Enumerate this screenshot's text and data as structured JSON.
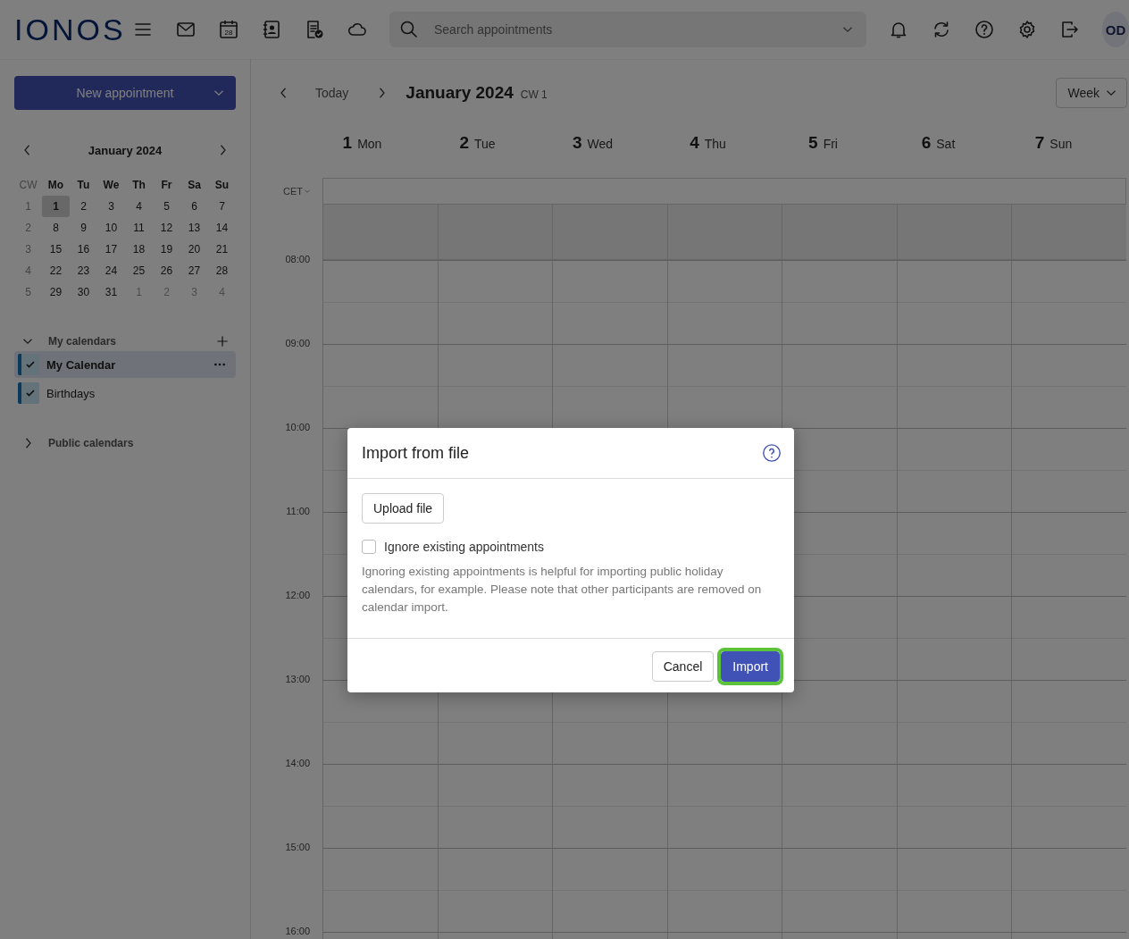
{
  "header": {
    "brand": "IONOS",
    "apps": [
      {
        "kind": "menu"
      },
      {
        "kind": "mail"
      },
      {
        "kind": "calendar",
        "label": "28"
      },
      {
        "kind": "contacts"
      },
      {
        "kind": "tasks"
      },
      {
        "kind": "cloud"
      }
    ],
    "search": {
      "placeholder": "Search appointments"
    },
    "actions": [
      {
        "kind": "bell"
      },
      {
        "kind": "sync"
      },
      {
        "kind": "help"
      },
      {
        "kind": "settings"
      },
      {
        "kind": "logout"
      }
    ],
    "avatar": "OD"
  },
  "sidebar": {
    "new_button": "New appointment",
    "mini_calendar": {
      "title": "January 2024",
      "week_label": "CW",
      "weekdays": [
        "Mo",
        "Tu",
        "We",
        "Th",
        "Fr",
        "Sa",
        "Su"
      ],
      "weeks": [
        {
          "cw": "1",
          "days": [
            {
              "label": "1",
              "selected": true,
              "outside": false
            },
            {
              "label": "2",
              "selected": false,
              "outside": false
            },
            {
              "label": "3",
              "selected": false,
              "outside": false
            },
            {
              "label": "4",
              "selected": false,
              "outside": false
            },
            {
              "label": "5",
              "selected": false,
              "outside": false
            },
            {
              "label": "6",
              "selected": false,
              "outside": false
            },
            {
              "label": "7",
              "selected": false,
              "outside": false
            }
          ]
        },
        {
          "cw": "2",
          "days": [
            {
              "label": "8",
              "selected": false,
              "outside": false
            },
            {
              "label": "9",
              "selected": false,
              "outside": false
            },
            {
              "label": "10",
              "selected": false,
              "outside": false
            },
            {
              "label": "11",
              "selected": false,
              "outside": false
            },
            {
              "label": "12",
              "selected": false,
              "outside": false
            },
            {
              "label": "13",
              "selected": false,
              "outside": false
            },
            {
              "label": "14",
              "selected": false,
              "outside": false
            }
          ]
        },
        {
          "cw": "3",
          "days": [
            {
              "label": "15",
              "selected": false,
              "outside": false
            },
            {
              "label": "16",
              "selected": false,
              "outside": false
            },
            {
              "label": "17",
              "selected": false,
              "outside": false
            },
            {
              "label": "18",
              "selected": false,
              "outside": false
            },
            {
              "label": "19",
              "selected": false,
              "outside": false
            },
            {
              "label": "20",
              "selected": false,
              "outside": false
            },
            {
              "label": "21",
              "selected": false,
              "outside": false
            }
          ]
        },
        {
          "cw": "4",
          "days": [
            {
              "label": "22",
              "selected": false,
              "outside": false
            },
            {
              "label": "23",
              "selected": false,
              "outside": false
            },
            {
              "label": "24",
              "selected": false,
              "outside": false
            },
            {
              "label": "25",
              "selected": false,
              "outside": false
            },
            {
              "label": "26",
              "selected": false,
              "outside": false
            },
            {
              "label": "27",
              "selected": false,
              "outside": false
            },
            {
              "label": "28",
              "selected": false,
              "outside": false
            }
          ]
        },
        {
          "cw": "5",
          "days": [
            {
              "label": "29",
              "selected": false,
              "outside": false
            },
            {
              "label": "30",
              "selected": false,
              "outside": false
            },
            {
              "label": "31",
              "selected": false,
              "outside": false
            },
            {
              "label": "1",
              "selected": false,
              "outside": true
            },
            {
              "label": "2",
              "selected": false,
              "outside": true
            },
            {
              "label": "3",
              "selected": false,
              "outside": true
            },
            {
              "label": "4",
              "selected": false,
              "outside": true
            }
          ]
        }
      ]
    },
    "my_calendars": {
      "title": "My calendars",
      "expanded": true,
      "items": [
        {
          "name": "My Calendar",
          "checked": true,
          "selected": true
        },
        {
          "name": "Birthdays",
          "checked": true,
          "selected": false
        }
      ]
    },
    "public_calendars": {
      "title": "Public calendars",
      "expanded": false
    }
  },
  "toolbar": {
    "today": "Today",
    "title": "January 2024",
    "week": "CW 1",
    "view": "Week"
  },
  "week": {
    "timezone": "CET",
    "days": [
      {
        "number": "1",
        "name": "Mon"
      },
      {
        "number": "2",
        "name": "Tue"
      },
      {
        "number": "3",
        "name": "Wed"
      },
      {
        "number": "4",
        "name": "Thu"
      },
      {
        "number": "5",
        "name": "Fri"
      },
      {
        "number": "6",
        "name": "Sat"
      },
      {
        "number": "7",
        "name": "Sun"
      }
    ],
    "hours": [
      "08:00",
      "09:00",
      "10:00",
      "11:00",
      "12:00",
      "13:00",
      "14:00",
      "15:00",
      "16:00"
    ]
  },
  "dialog": {
    "title": "Import from file",
    "upload": "Upload file",
    "checkbox": {
      "label": "Ignore existing appointments",
      "checked": false
    },
    "note": "Ignoring existing appointments is helpful for importing public holiday calendars, for example. Please note that other participants are removed on calendar import.",
    "buttons": [
      {
        "label": "Cancel",
        "kind": "secondary"
      },
      {
        "label": "Import",
        "kind": "primary"
      }
    ]
  }
}
